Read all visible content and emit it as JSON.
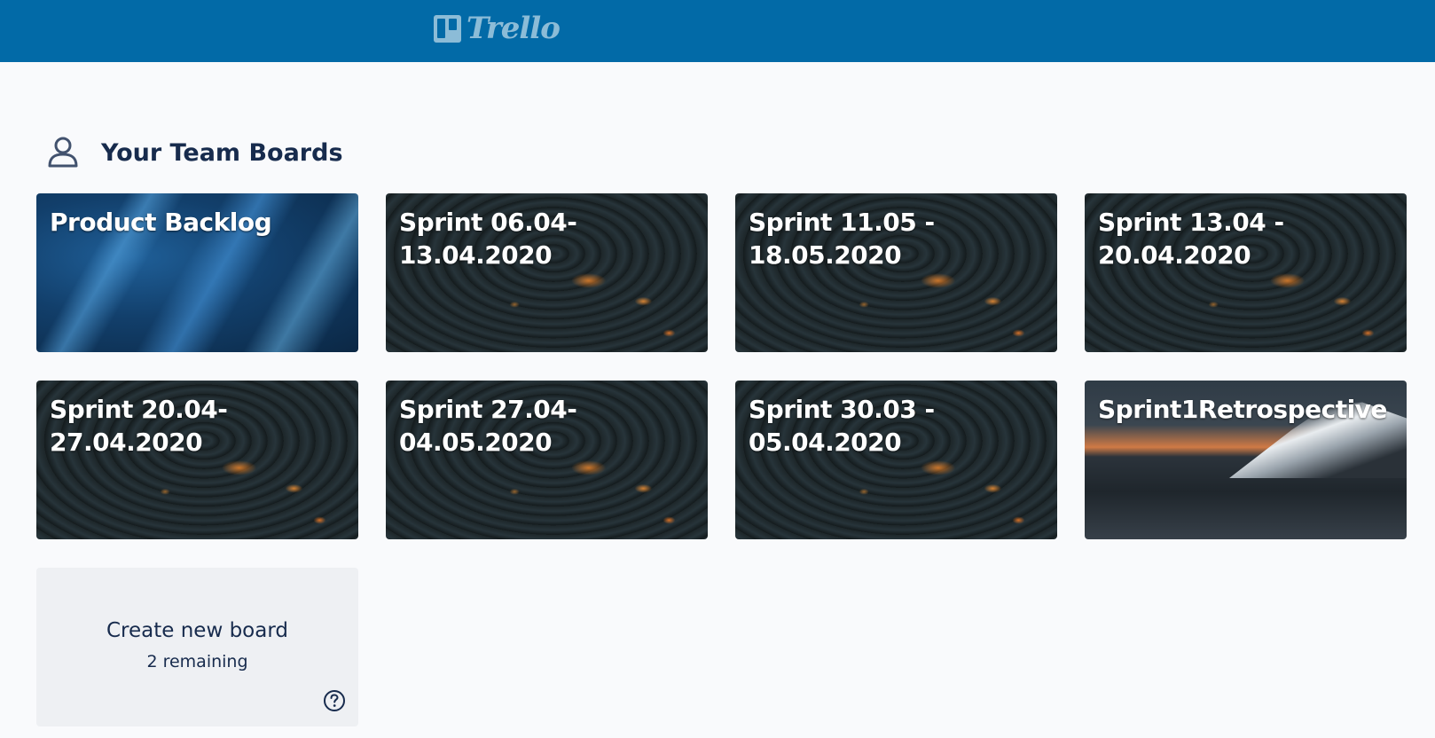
{
  "header": {
    "logo_text": "Trello",
    "bar_color": "#026aa7"
  },
  "section": {
    "title": "Your Team Boards",
    "icon": "user-icon"
  },
  "boards": [
    {
      "title": "Product Backlog",
      "background": "blue-abstract"
    },
    {
      "title": "Sprint 06.04-\n13.04.2020",
      "background": "dark-ripple"
    },
    {
      "title": "Sprint 11.05 -\n18.05.2020",
      "background": "dark-ripple"
    },
    {
      "title": "Sprint 13.04 -\n20.04.2020",
      "background": "dark-ripple"
    },
    {
      "title": "Sprint 20.04-\n27.04.2020",
      "background": "dark-ripple"
    },
    {
      "title": "Sprint 27.04-\n04.05.2020",
      "background": "dark-ripple"
    },
    {
      "title": "Sprint 30.03 -\n05.04.2020",
      "background": "dark-ripple"
    },
    {
      "title": "Sprint1Retrospective",
      "background": "snowy-mountain"
    }
  ],
  "create_board": {
    "label": "Create new board",
    "remaining": "2 remaining",
    "help_icon": "question-circle-icon"
  }
}
